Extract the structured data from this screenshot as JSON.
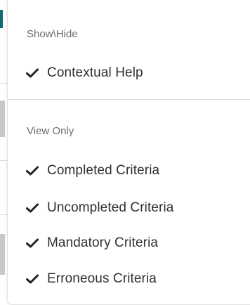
{
  "menu": {
    "sections": [
      {
        "header": "Show\\Hide",
        "items": [
          {
            "label": "Contextual Help",
            "checked": true,
            "icon": "checkmark-icon"
          }
        ]
      },
      {
        "header": "View Only",
        "items": [
          {
            "label": "Completed Criteria",
            "checked": true,
            "icon": "checkmark-icon"
          },
          {
            "label": "Uncompleted Criteria",
            "checked": true,
            "icon": "checkmark-icon"
          },
          {
            "label": "Mandatory Criteria",
            "checked": true,
            "icon": "checkmark-icon"
          },
          {
            "label": "Erroneous Criteria",
            "checked": true,
            "icon": "checkmark-icon"
          }
        ]
      }
    ]
  },
  "colors": {
    "accent": "#0e6b73",
    "text": "#2f2f2f",
    "header_text": "#6b6b6b",
    "divider": "#dcdcdc"
  }
}
